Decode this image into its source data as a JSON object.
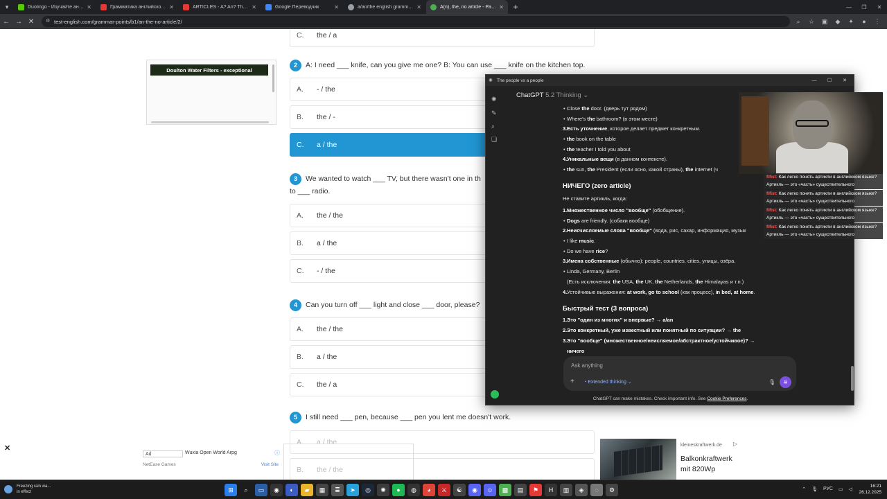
{
  "tabs": [
    {
      "title": "Duolingo - Изучайте английск",
      "color": "#58cc02",
      "active": false
    },
    {
      "title": "Грамматика английского язык",
      "color": "#e53935",
      "active": false
    },
    {
      "title": "ARTICLES - A? An? The? | How",
      "color": "#e53935",
      "active": false
    },
    {
      "title": "Google Переводчик",
      "color": "#4285f4",
      "active": false
    },
    {
      "title": "a/an/the english grammar gam",
      "color": "#9aa0a6",
      "active": false
    },
    {
      "title": "A(n), the, no article - Page 2 of",
      "color": "#4caf50",
      "active": true
    }
  ],
  "address": {
    "url": "test-english.com/grammar-points/b1/an-the-no-article/2/"
  },
  "ad_top": {
    "text": "Doulton Water Filters - exceptional"
  },
  "quiz": {
    "q1_tail": {
      "letter": "C.",
      "text": "the / a"
    },
    "q2": {
      "num": "2",
      "text": "A: I need ___ knife, can you give me one? B: You can use ___ knife on the kitchen top.",
      "options": [
        {
          "letter": "A.",
          "text": "- / the"
        },
        {
          "letter": "B.",
          "text": "the / -"
        },
        {
          "letter": "C.",
          "text": "a / the"
        }
      ]
    },
    "q3": {
      "num": "3",
      "line1": "We wanted to watch ___ TV, but there wasn't one in th",
      "line2": "to ___ radio.",
      "options": [
        {
          "letter": "A.",
          "text": "the / the"
        },
        {
          "letter": "B.",
          "text": "a / the"
        },
        {
          "letter": "C.",
          "text": "- / the"
        }
      ]
    },
    "q4": {
      "num": "4",
      "text": "Can you turn off ___ light and close ___ door, please?",
      "options": [
        {
          "letter": "A.",
          "text": "the / the"
        },
        {
          "letter": "B.",
          "text": "a / the"
        },
        {
          "letter": "C.",
          "text": "the / a"
        }
      ]
    },
    "q5": {
      "num": "5",
      "text": "I still need ___ pen, because ___ pen you lent me doesn't work.",
      "options": [
        {
          "letter": "A.",
          "text": "a / the"
        },
        {
          "letter": "B.",
          "text": "the / the"
        }
      ]
    }
  },
  "ad_bottom": {
    "label": "Ad",
    "title": "Wuxia Open World Arpg",
    "source": "NetEase Games",
    "visit": "Visit Site",
    "close": "✕"
  },
  "ad_right": {
    "domain": "kleineskraftwerk.de",
    "title": "Balkonkraftwerk mit 820Wp"
  },
  "gpt": {
    "window_title": "The people vs a people",
    "model": "ChatGPT",
    "version": "5.2 Thinking",
    "lines": {
      "l1a": "Close ",
      "l1b": "the",
      "l1c": " door. (дверь тут рядом)",
      "l2a": "Where's ",
      "l2b": "the",
      "l2c": " bathroom? (в этом месте)",
      "l3n": "3.",
      "l3b": "Есть уточнение",
      "l3c": ", которое делает предмет конкретным.",
      "l4b": "the",
      "l4c": " book on the table",
      "l5b": "the",
      "l5c": " teacher I told you about",
      "l6n": "4.",
      "l6b": "Уникальные вещи",
      "l6c": " (в данном контексте).",
      "l7a": "the",
      "l7b": " sun, ",
      "l7c": "the",
      "l7d": " President (если ясно, какой страны), ",
      "l7e": "the",
      "l7f": " internet (ч",
      "h_zero": "НИЧЕГО (zero article)",
      "zero_intro": "Не ставите артикль, когда:",
      "z1n": "1.",
      "z1b": "Множественное число \"вообще\"",
      "z1c": " (обобщение).",
      "z2b": "Dogs",
      "z2c": " are friendly. (собаки вообще)",
      "z3n": "2.",
      "z3b": "Неисчисляемые слова \"вообще\"",
      "z3c": " (вода, рис, сахар, информация, музык",
      "z4a": "I like ",
      "z4b": "music",
      "z4c": ".",
      "z5a": "Do we have ",
      "z5b": "rice",
      "z5c": "?",
      "z6n": "3.",
      "z6b": "Имена собственные",
      "z6c": " (обычно): people, countries, cities, улицы, озёра.",
      "z7": "Linda, Germany, Berlin",
      "z8a": "(Есть исключения: ",
      "z8b": "the",
      "z8c": " USA, ",
      "z8d": "the",
      "z8e": " UK, ",
      "z8f": "the",
      "z8g": " Netherlands, ",
      "z8h": "the",
      "z8i": " Himalayas и т.п.)",
      "z9n": "4.",
      "z9a": "Устойчивые выражения: ",
      "z9b": "at work, go to school",
      "z9c": " (как процесс), ",
      "z9d": "in bed, at home",
      "z9e": ".",
      "h_quiz": "Быстрый тест (3 вопроса)",
      "t1n": "1.",
      "t1b": "Это \"один из многих\" и впервые?",
      "t1c": " → ",
      "t1d": "a/an",
      "t2n": "2.",
      "t2b": "Это конкретный, уже известный или понятный по ситуации?",
      "t2c": " → ",
      "t2d": "the",
      "t3n": "3.",
      "t3b": "Это \"вообще\" (множественное/неис",
      "t3c": "ляемое/абстрактное/устойчивое)?",
      "t3d": " →",
      "t4": "ничего"
    },
    "input_placeholder": "Ask anything",
    "extended_thinking": "Extended thinking",
    "footer": "ChatGPT can make mistakes. Check important info. See ",
    "footer_link": "Cookie Preferences",
    "footer_end": "."
  },
  "chat_overlay": [
    {
      "user": "fifist:",
      "text": "Как легко понять артикли в английском языке? Артикль — это «часть» существительного"
    },
    {
      "user": "fifist:",
      "text": "Как легко понять артикли в английском языке? Артикль — это «часть» существительного"
    },
    {
      "user": "fifist:",
      "text": "Как легко понять артикли в английском языке? Артикль — это «часть» существительного"
    },
    {
      "user": "fifist:",
      "text": "Как легко понять артикли в английском языке? Артикль — это «часть» существительного"
    }
  ],
  "taskbar": {
    "weather_line1": "Freezing rain wa...",
    "weather_line2": "in effect",
    "lang": "РУС",
    "time": "16:21",
    "date": "26.12.2025"
  }
}
